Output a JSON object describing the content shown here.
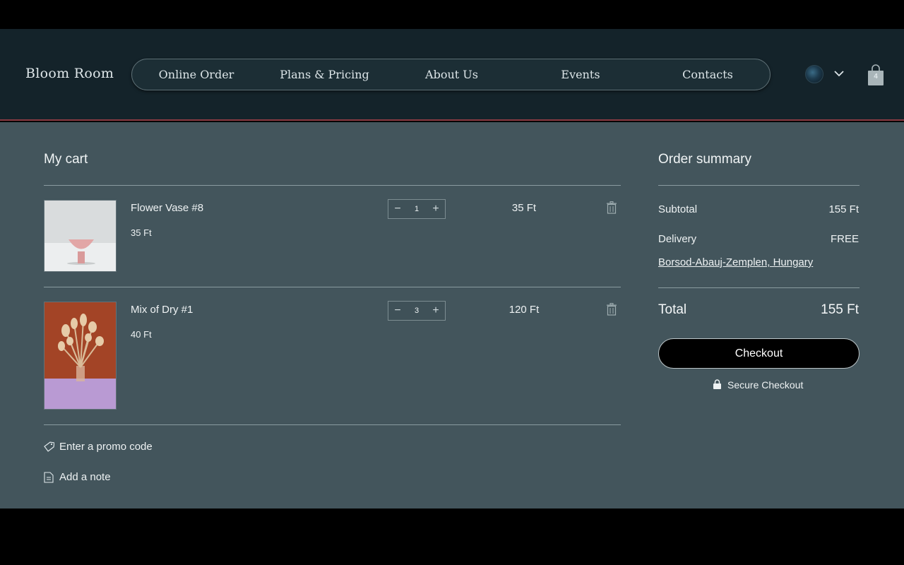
{
  "brand": {
    "name": "Bloom Room"
  },
  "nav": {
    "items": [
      {
        "label": "Online Order"
      },
      {
        "label": "Plans & Pricing"
      },
      {
        "label": "About Us"
      },
      {
        "label": "Events"
      },
      {
        "label": "Contacts"
      }
    ]
  },
  "header": {
    "cart_count": "4",
    "icons": [
      "avatar",
      "chevron-down-icon",
      "shopping-bag-icon"
    ]
  },
  "cart": {
    "title": "My cart",
    "items": [
      {
        "name": "Flower Vase #8",
        "unit_price": "35 Ft",
        "quantity": "1",
        "total": "35 Ft"
      },
      {
        "name": "Mix of Dry #1",
        "unit_price": "40 Ft",
        "quantity": "3",
        "total": "120 Ft"
      }
    ],
    "promo_label": "Enter a promo code",
    "note_label": "Add a note"
  },
  "summary": {
    "title": "Order summary",
    "subtotal_label": "Subtotal",
    "subtotal_value": "155 Ft",
    "delivery_label": "Delivery",
    "delivery_value": "FREE",
    "location": "Borsod-Abauj-Zemplen, Hungary",
    "total_label": "Total",
    "total_value": "155 Ft",
    "checkout_label": "Checkout",
    "secure_label": "Secure Checkout"
  },
  "colors": {
    "header_bg": "#14232a",
    "main_bg": "#43555c",
    "accent_line": "#8a3a42",
    "button_bg": "#000000"
  }
}
